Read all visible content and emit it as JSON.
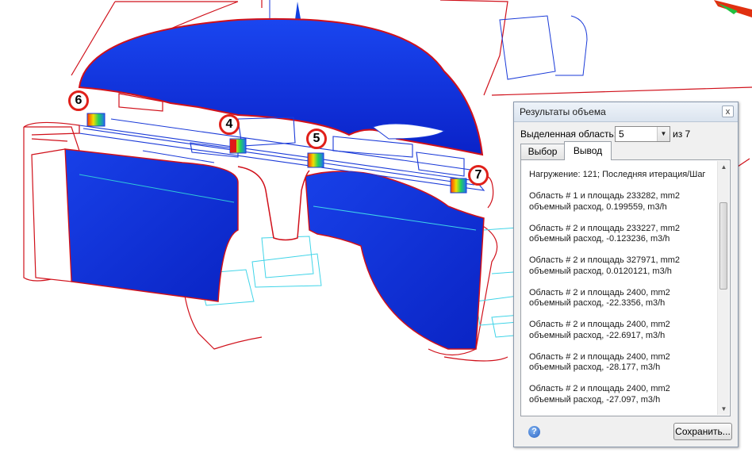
{
  "markers": [
    "6",
    "4",
    "5",
    "7"
  ],
  "dialog": {
    "title": "Результаты объема",
    "close_glyph": "x",
    "region_label": "Выделенная область:",
    "region_value": "5",
    "region_total": "из 7",
    "tabs": [
      "Выбор",
      "Вывод"
    ],
    "output_text": "Нагружение: 121; Последняя итерация/Шаг\n\nОбласть # 1 и площадь 233282, mm2\nобъемный расход, 0.199559, m3/h\n\nОбласть # 2 и площадь 233227, mm2\nобъемный расход, -0.123236, m3/h\n\nОбласть # 2 и площадь 327971, mm2\nобъемный расход,  0.0120121, m3/h\n\nОбласть # 2 и площадь 2400, mm2\nобъемный расход, -22.3356, m3/h\n\nОбласть # 2 и площадь 2400, mm2\nобъемный расход, -22.6917, m3/h\n\nОбласть # 2 и площадь 2400, mm2\nобъемный расход, -28.177, m3/h\n\nОбласть # 2 и площадь 2400, mm2\nобъемный расход, -27.097, m3/h",
    "save_label": "Сохранить...",
    "help_glyph": "?"
  },
  "colors": {
    "surface_blue": "#0a2fd6",
    "outline_red": "#d0101a",
    "wire_cyan": "#3fd4e8",
    "marker_border": "#e0201a"
  }
}
